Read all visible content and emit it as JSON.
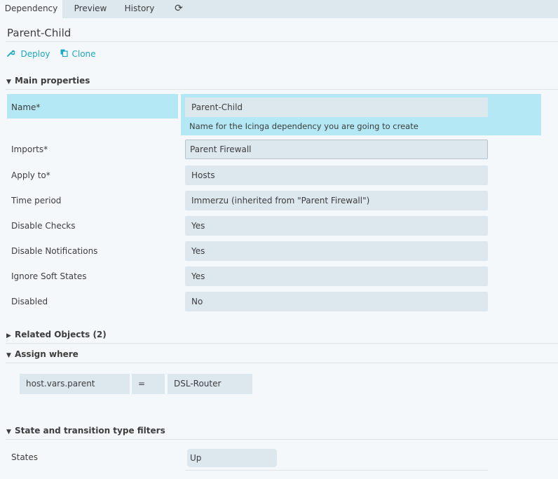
{
  "tabs": {
    "dependency": "Dependency",
    "preview": "Preview",
    "history": "History",
    "refresh_icon": "⟳"
  },
  "page_title": "Parent-Child",
  "actions": {
    "deploy": "Deploy",
    "clone": "Clone"
  },
  "sections": {
    "main": "Main properties",
    "related": "Related Objects (2)",
    "assign": "Assign where",
    "state_filters": "State and transition type filters"
  },
  "fields": {
    "name_label": "Name*",
    "name_value": "Parent-Child",
    "name_hint": "Name for the Icinga dependency you are going to create",
    "imports_label": "Imports*",
    "imports_value": "Parent Firewall",
    "apply_to_label": "Apply to*",
    "apply_to_value": "Hosts",
    "time_period_label": "Time period",
    "time_period_value": "Immerzu (inherited from \"Parent Firewall\")",
    "disable_checks_label": "Disable Checks",
    "disable_checks_value": "Yes",
    "disable_notifications_label": "Disable Notifications",
    "disable_notifications_value": "Yes",
    "ignore_soft_states_label": "Ignore Soft States",
    "ignore_soft_states_value": "Yes",
    "disabled_label": "Disabled",
    "disabled_value": "No"
  },
  "assign_where": {
    "property": "host.vars.parent",
    "operator": "=",
    "value": "DSL-Router"
  },
  "states": {
    "label": "States",
    "value": "Up"
  },
  "colors": {
    "accent": "#1ba8c4",
    "highlight": "#b4e8f4",
    "field_bg": "#dde7ee",
    "tab_bar": "#dde7ee"
  }
}
